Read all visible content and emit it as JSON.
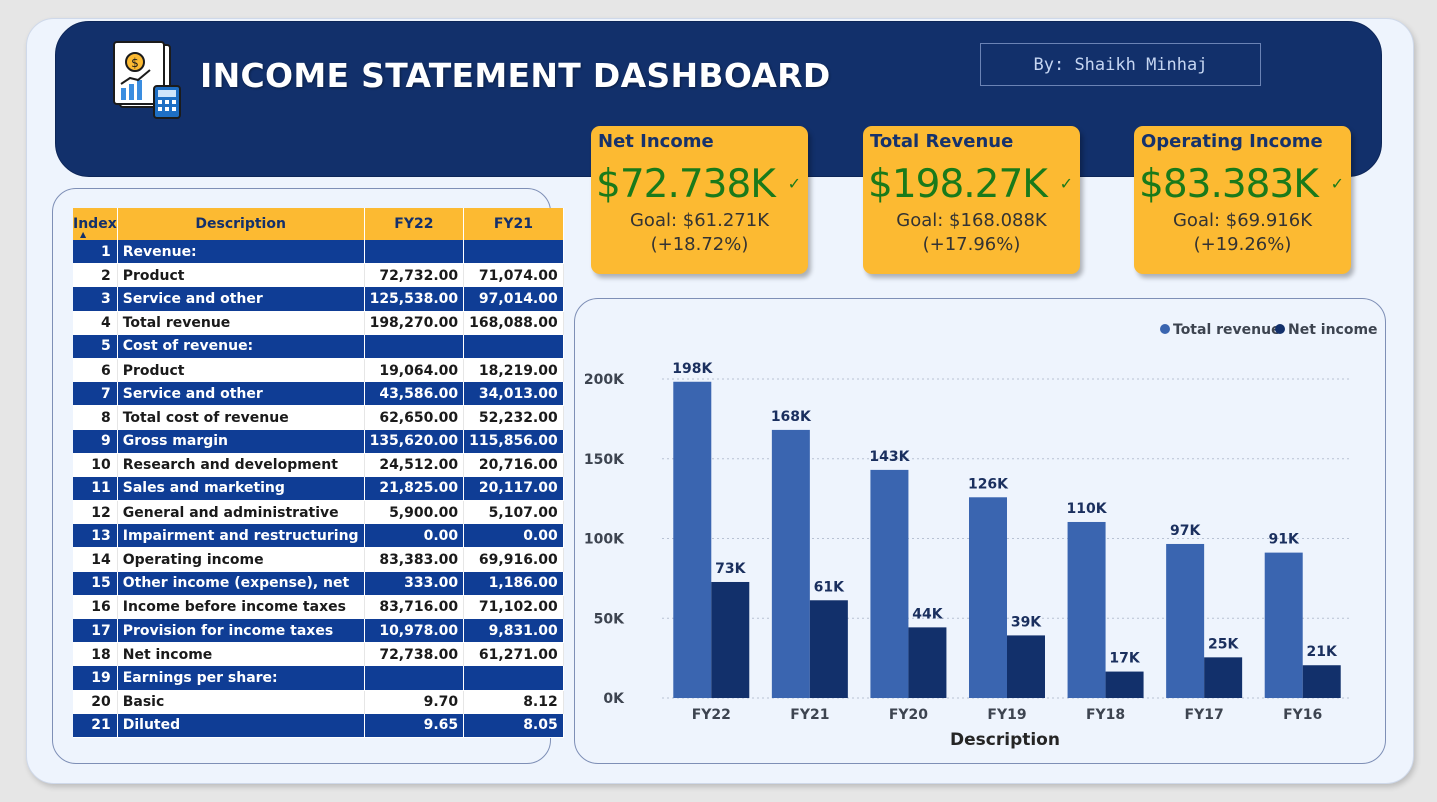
{
  "header": {
    "title": "INCOME STATEMENT DASHBOARD",
    "byline": "By: Shaikh Minhaj"
  },
  "kpis": [
    {
      "title": "Net Income",
      "value": "$72.738K",
      "goal": "Goal: $61.271K",
      "change": "(+18.72%)"
    },
    {
      "title": "Total Revenue",
      "value": "$198.27K",
      "goal": "Goal: $168.088K",
      "change": "(+17.96%)"
    },
    {
      "title": "Operating Income",
      "value": "$83.383K",
      "goal": "Goal: $69.916K",
      "change": "(+19.26%)"
    }
  ],
  "colors": {
    "navy": "#12306b",
    "kpi_bg": "#fcba32",
    "kpi_value": "#1a7a1a",
    "table_blue": "#0f3d95",
    "bar_revenue": "#3a65b0",
    "bar_income": "#12306b"
  },
  "icons": {
    "logo": "financial-report-calculator-icon",
    "check": "check-icon",
    "sort": "sort-ascending-icon"
  },
  "table": {
    "headers": {
      "index": "Index",
      "description": "Description",
      "fy22": "FY22",
      "fy21": "FY21"
    },
    "sort": "Index ascending",
    "rows": [
      {
        "index": "1",
        "description": "Revenue:",
        "fy22": "",
        "fy21": ""
      },
      {
        "index": "2",
        "description": "Product",
        "fy22": "72,732.00",
        "fy21": "71,074.00"
      },
      {
        "index": "3",
        "description": "Service and other",
        "fy22": "125,538.00",
        "fy21": "97,014.00"
      },
      {
        "index": "4",
        "description": "Total revenue",
        "fy22": "198,270.00",
        "fy21": "168,088.00"
      },
      {
        "index": "5",
        "description": "Cost of revenue:",
        "fy22": "",
        "fy21": ""
      },
      {
        "index": "6",
        "description": "Product",
        "fy22": "19,064.00",
        "fy21": "18,219.00"
      },
      {
        "index": "7",
        "description": "Service and other",
        "fy22": "43,586.00",
        "fy21": "34,013.00"
      },
      {
        "index": "8",
        "description": "Total cost of revenue",
        "fy22": "62,650.00",
        "fy21": "52,232.00"
      },
      {
        "index": "9",
        "description": "Gross margin",
        "fy22": "135,620.00",
        "fy21": "115,856.00"
      },
      {
        "index": "10",
        "description": "Research and development",
        "fy22": "24,512.00",
        "fy21": "20,716.00"
      },
      {
        "index": "11",
        "description": "Sales and marketing",
        "fy22": "21,825.00",
        "fy21": "20,117.00"
      },
      {
        "index": "12",
        "description": "General and administrative",
        "fy22": "5,900.00",
        "fy21": "5,107.00"
      },
      {
        "index": "13",
        "description": "Impairment and restructuring",
        "fy22": "0.00",
        "fy21": "0.00"
      },
      {
        "index": "14",
        "description": "Operating income",
        "fy22": "83,383.00",
        "fy21": "69,916.00"
      },
      {
        "index": "15",
        "description": "Other income (expense), net",
        "fy22": "333.00",
        "fy21": "1,186.00"
      },
      {
        "index": "16",
        "description": "Income before income taxes",
        "fy22": "83,716.00",
        "fy21": "71,102.00"
      },
      {
        "index": "17",
        "description": "Provision for income taxes",
        "fy22": "10,978.00",
        "fy21": "9,831.00"
      },
      {
        "index": "18",
        "description": "Net income",
        "fy22": "72,738.00",
        "fy21": "61,271.00"
      },
      {
        "index": "19",
        "description": "Earnings per share:",
        "fy22": "",
        "fy21": ""
      },
      {
        "index": "20",
        "description": "Basic",
        "fy22": "9.70",
        "fy21": "8.12"
      },
      {
        "index": "21",
        "description": "Diluted",
        "fy22": "9.65",
        "fy21": "8.05"
      }
    ]
  },
  "chart_data": {
    "type": "bar",
    "title": "",
    "xlabel": "Description",
    "ylabel": "",
    "categories": [
      "FY22",
      "FY21",
      "FY20",
      "FY19",
      "FY18",
      "FY17",
      "FY16"
    ],
    "series": [
      {
        "name": "Total revenue",
        "values": [
          198270,
          168088,
          143015,
          125843,
          110360,
          96571,
          91154
        ],
        "labels": [
          "198K",
          "168K",
          "143K",
          "126K",
          "110K",
          "97K",
          "91K"
        ],
        "color": "#3a65b0"
      },
      {
        "name": "Net income",
        "values": [
          72738,
          61271,
          44281,
          39240,
          16571,
          25489,
          20539
        ],
        "labels": [
          "73K",
          "61K",
          "44K",
          "39K",
          "17K",
          "25K",
          "21K"
        ],
        "color": "#12306b"
      }
    ],
    "ylim": [
      0,
      200000
    ],
    "yticks": [
      0,
      50000,
      100000,
      150000,
      200000
    ],
    "ytick_labels": [
      "0K",
      "50K",
      "100K",
      "150K",
      "200K"
    ],
    "grid": true,
    "legend": "top-right"
  }
}
